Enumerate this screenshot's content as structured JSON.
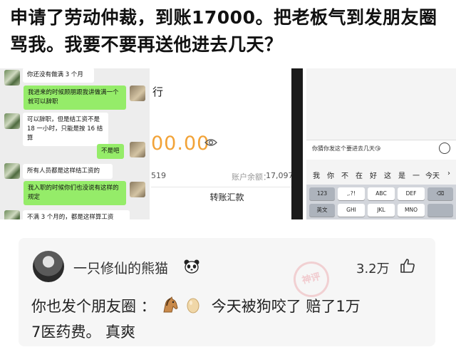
{
  "post": {
    "title": "申请了劳动仲裁，到账17000。把老板气到发朋友圈骂我。我要不要再送他进去几天？"
  },
  "chat_screenshot": {
    "messages": [
      {
        "side": "in",
        "text": "你还没有做满 3 个月"
      },
      {
        "side": "out",
        "text": "我进来的时候顾朋跟我讲做满一个就可以辞职"
      },
      {
        "side": "in",
        "text": "可以辞职，但是结工资不是 18 一小时，只能是按 16 结算"
      },
      {
        "side": "out",
        "text": "不是吧"
      },
      {
        "side": "in",
        "text": "所有人员都是这样结工资的"
      },
      {
        "side": "out",
        "text": "我入职的时候你们也没说有这样的规定"
      },
      {
        "side": "in",
        "text": "不满 3 个月的，都是这样算工资"
      }
    ]
  },
  "bank_screenshot": {
    "bank_name": "行",
    "amount": "00.00",
    "account_suffix": "519",
    "balance_label": "账户余额：",
    "balance_value": "17,097",
    "transfer_label": "转账汇款"
  },
  "keyboard_screenshot": {
    "input_text": "你猜你发这个要进去几天😘",
    "candidates": [
      "我",
      "你",
      "不",
      "在",
      "好",
      "这",
      "是",
      "一",
      "今天",
      "›"
    ],
    "row1": [
      "123",
      ",.?!",
      "ABC",
      "DEF",
      "⌫"
    ],
    "row2": [
      "英文",
      "GHI",
      "JKL",
      "MNO"
    ]
  },
  "comment": {
    "username": "一只修仙的熊猫",
    "likes": "3.2万",
    "stamp_text": "神评",
    "line1_before": "你也发个朋友圈 ：",
    "line1_after": "今天被狗咬了 赔了1万",
    "line2": "7医药费。 真爽"
  },
  "colors": {
    "bubble_out": "#95ec69",
    "amount_orange": "#f2a338",
    "card_bg": "#f6f6f6"
  }
}
